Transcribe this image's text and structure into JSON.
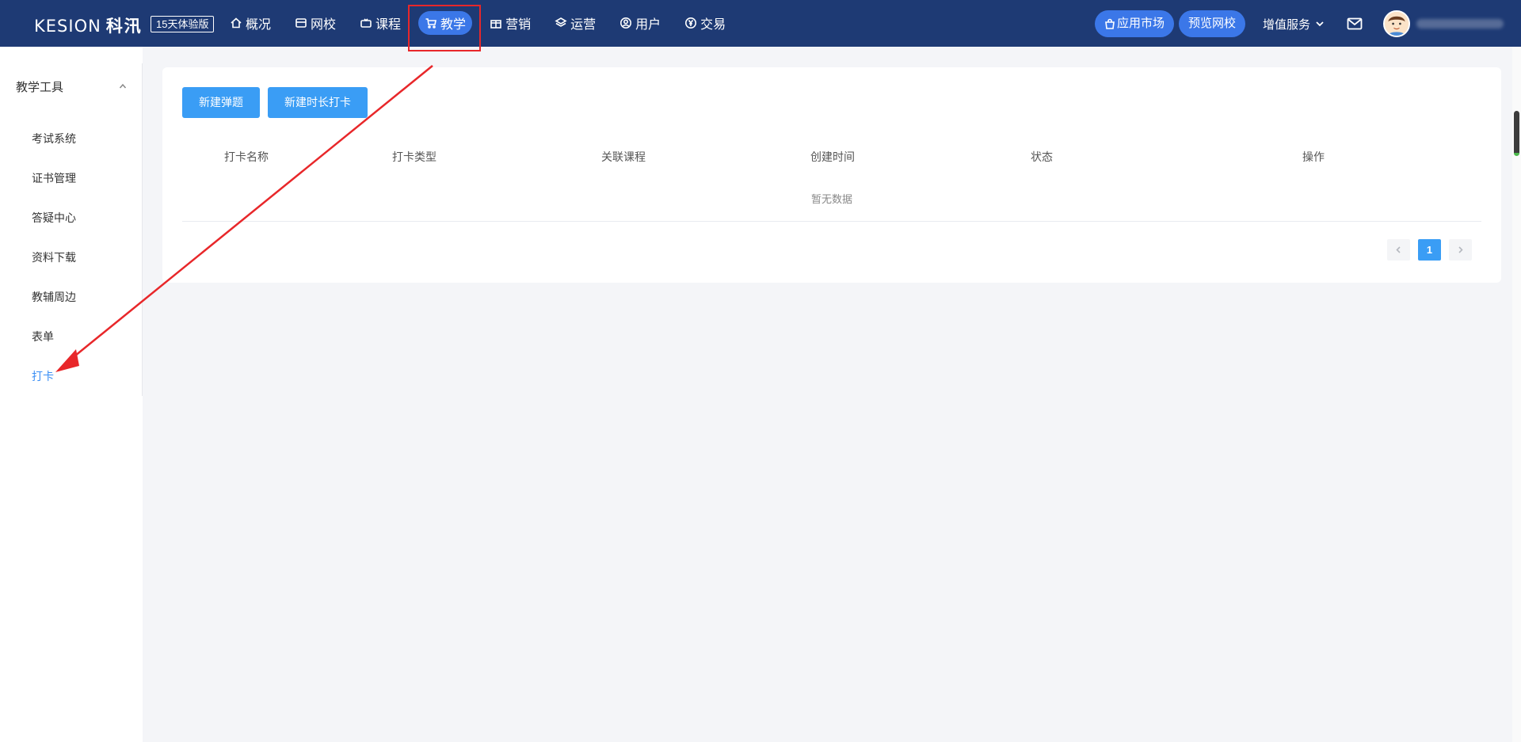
{
  "brand": {
    "latin": "KESION",
    "cn": "科汛"
  },
  "trial_badge": "15天体验版",
  "nav": [
    {
      "label": "概况",
      "icon": "home-icon",
      "active": false
    },
    {
      "label": "网校",
      "icon": "store-icon",
      "active": false
    },
    {
      "label": "课程",
      "icon": "video-icon",
      "active": false
    },
    {
      "label": "教学",
      "icon": "cart-icon",
      "active": true
    },
    {
      "label": "营销",
      "icon": "gift-icon",
      "active": false
    },
    {
      "label": "运营",
      "icon": "layers-icon",
      "active": false
    },
    {
      "label": "用户",
      "icon": "user-circle-icon",
      "active": false
    },
    {
      "label": "交易",
      "icon": "yen-icon",
      "active": false
    }
  ],
  "toolbar": {
    "app_market": "应用市场",
    "preview_school": "预览网校",
    "value_added": "增值服务"
  },
  "sidebar": {
    "group": "教学工具",
    "items": [
      {
        "label": "考试系统",
        "active": false
      },
      {
        "label": "证书管理",
        "active": false
      },
      {
        "label": "答疑中心",
        "active": false
      },
      {
        "label": "资料下载",
        "active": false
      },
      {
        "label": "教辅周边",
        "active": false
      },
      {
        "label": "表单",
        "active": false
      },
      {
        "label": "打卡",
        "active": true
      }
    ]
  },
  "actions": {
    "new_popup": "新建弹题",
    "new_duration_checkin": "新建时长打卡"
  },
  "table": {
    "columns": [
      "打卡名称",
      "打卡类型",
      "关联课程",
      "创建时间",
      "状态",
      "操作"
    ],
    "empty_text": "暂无数据"
  },
  "pagination": {
    "current": "1"
  },
  "colors": {
    "header_bg": "#1e3a74",
    "accent": "#3b77e8",
    "button": "#3a9df5",
    "annotation": "#e8272a"
  }
}
